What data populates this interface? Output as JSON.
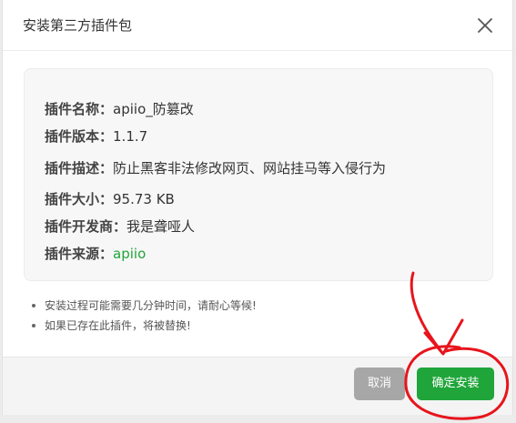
{
  "dialog": {
    "title": "安装第三方插件包"
  },
  "plugin_info": {
    "rows": [
      {
        "label": "插件名称：",
        "value": "apiio_防篡改"
      },
      {
        "label": "插件版本：",
        "value": "1.1.7"
      },
      {
        "label": "插件描述：",
        "value": "防止黑客非法修改网页、网站挂马等入侵行为"
      },
      {
        "label": "插件大小：",
        "value": "95.73 KB"
      },
      {
        "label": "插件开发商：",
        "value": "我是聋哑人"
      },
      {
        "label": "插件来源：",
        "value": "apiio"
      }
    ]
  },
  "notes": [
    "安装过程可能需要几分钟时间，请耐心等候!",
    "如果已存在此插件，将被替换!"
  ],
  "footer": {
    "cancel_label": "取消",
    "confirm_label": "确定安装"
  },
  "colors": {
    "accent": "#20a53a",
    "cancel": "#a7a7a7",
    "annotation": "#e8141c"
  }
}
